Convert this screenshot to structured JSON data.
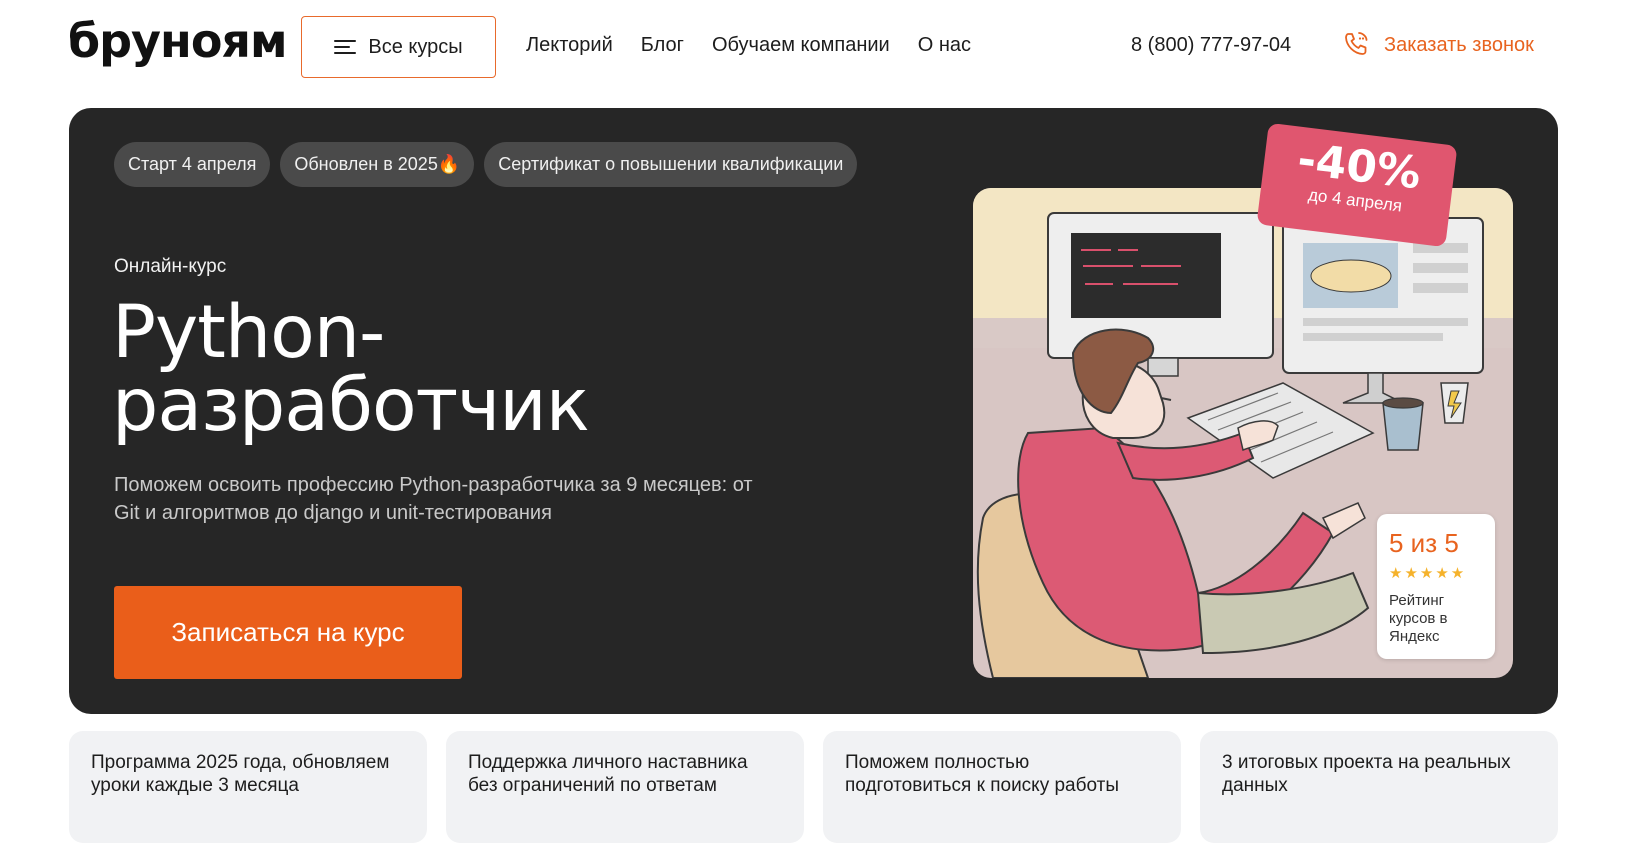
{
  "header": {
    "logo": "бруноям",
    "all_courses": "Все курсы",
    "nav": [
      "Лекторий",
      "Блог",
      "Обучаем компании",
      "О нас"
    ],
    "phone": "8 (800) 777-97-04",
    "call": "Заказать звонок"
  },
  "hero": {
    "chips": [
      "Старт 4 апреля",
      "Обновлен в 2025🔥",
      "Сертификат о повышении квалификации"
    ],
    "subtitle": "Онлайн-курс",
    "title_line1": "Python-",
    "title_line2": "разработчик",
    "description": "Поможем освоить профессию Python-разработчика за 9 месяцев: от Git и алгоритмов до django и unit-тестирования",
    "cta": "Записаться на курс",
    "discount": "-40%",
    "discount_note": "до 4 апреля",
    "rating_score": "5 из 5",
    "rating_stars": "★★★★★",
    "rating_text": "Рейтинг курсов в Яндекс"
  },
  "features": [
    "Программа 2025 года, обновляем уроки каждые 3 месяца",
    "Поддержка личного наставника без ограничений по ответам",
    "Поможем полностью подготовиться к поиску работы",
    "3 итоговых проекта на реальных данных"
  ],
  "colors": {
    "accent": "#ea5e1a",
    "hero_bg": "#262626",
    "badge": "#e0566f",
    "card_bg": "#f1f2f4"
  }
}
